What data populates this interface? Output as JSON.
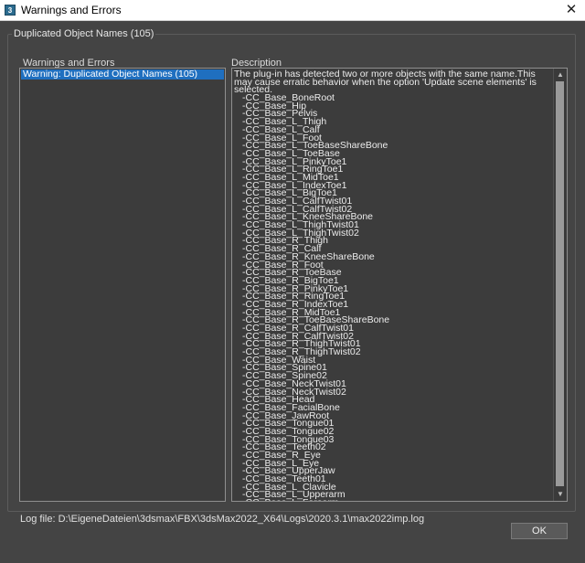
{
  "window": {
    "title": "Warnings and Errors",
    "close_glyph": "✕",
    "app_icon": "3"
  },
  "group": {
    "title": "Duplicated Object Names (105)"
  },
  "left_panel": {
    "label": "Warnings and Errors",
    "items": [
      {
        "label": "Warning: Duplicated Object Names (105)",
        "selected": true
      }
    ]
  },
  "right_panel": {
    "label": "Description",
    "intro": "The plug-in has detected two or more objects with the same name.This may cause erratic behavior when the option 'Update scene elements' is selected.",
    "names": [
      "-CC_Base_BoneRoot",
      "-CC_Base_Hip",
      "-CC_Base_Pelvis",
      "-CC_Base_L_Thigh",
      "-CC_Base_L_Calf",
      "-CC_Base_L_Foot",
      "-CC_Base_L_ToeBaseShareBone",
      "-CC_Base_L_ToeBase",
      "-CC_Base_L_PinkyToe1",
      "-CC_Base_L_RingToe1",
      "-CC_Base_L_MidToe1",
      "-CC_Base_L_IndexToe1",
      "-CC_Base_L_BigToe1",
      "-CC_Base_L_CalfTwist01",
      "-CC_Base_L_CalfTwist02",
      "-CC_Base_L_KneeShareBone",
      "-CC_Base_L_ThighTwist01",
      "-CC_Base_L_ThighTwist02",
      "-CC_Base_R_Thigh",
      "-CC_Base_R_Calf",
      "-CC_Base_R_KneeShareBone",
      "-CC_Base_R_Foot",
      "-CC_Base_R_ToeBase",
      "-CC_Base_R_BigToe1",
      "-CC_Base_R_PinkyToe1",
      "-CC_Base_R_RingToe1",
      "-CC_Base_R_IndexToe1",
      "-CC_Base_R_MidToe1",
      "-CC_Base_R_ToeBaseShareBone",
      "-CC_Base_R_CalfTwist01",
      "-CC_Base_R_CalfTwist02",
      "-CC_Base_R_ThighTwist01",
      "-CC_Base_R_ThighTwist02",
      "-CC_Base_Waist",
      "-CC_Base_Spine01",
      "-CC_Base_Spine02",
      "-CC_Base_NeckTwist01",
      "-CC_Base_NeckTwist02",
      "-CC_Base_Head",
      "-CC_Base_FacialBone",
      "-CC_Base_JawRoot",
      "-CC_Base_Tongue01",
      "-CC_Base_Tongue02",
      "-CC_Base_Tongue03",
      "-CC_Base_Teeth02",
      "-CC_Base_R_Eye",
      "-CC_Base_L_Eye",
      "-CC_Base_UpperJaw",
      "-CC_Base_Teeth01",
      "-CC_Base_L_Clavicle",
      "-CC_Base_L_Upperarm",
      "-CC_Base_L_Forearm"
    ],
    "scroll_up_glyph": "▲",
    "scroll_down_glyph": "▼"
  },
  "footer": {
    "log_file": "Log file: D:\\EigeneDateien\\3dsmax\\FBX\\3dsMax2022_X64\\Logs\\2020.3.1\\max2022imp.log",
    "ok_label": "OK"
  },
  "colors": {
    "background": "#444444",
    "selection": "#1f6fbf",
    "titlebar": "#ffffff"
  }
}
